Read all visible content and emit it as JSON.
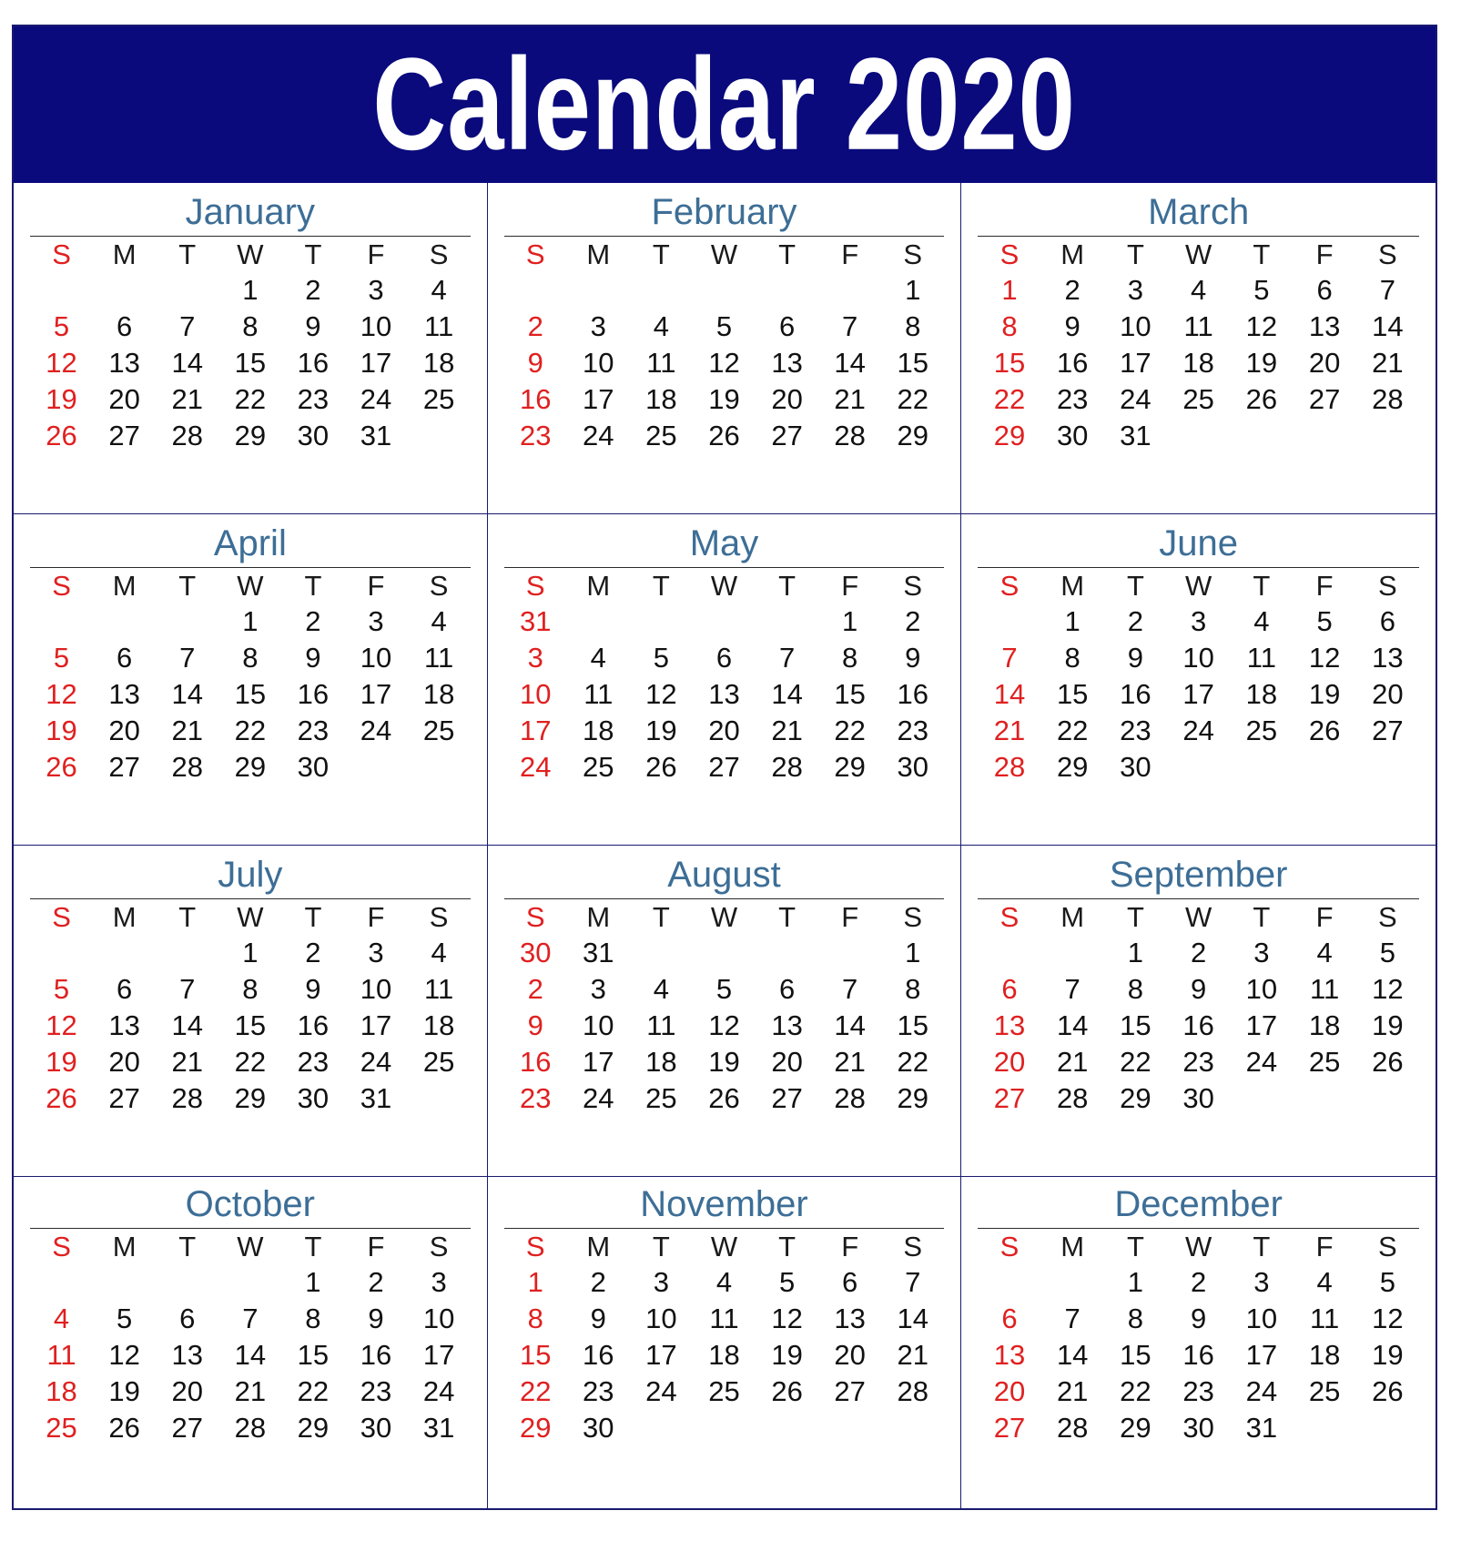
{
  "title": "Calendar 2020",
  "year": "2020",
  "colors": {
    "header_background": "#0a0a7d",
    "header_text": "#ffffff",
    "month_name": "#3d6e96",
    "sunday": "#e02020",
    "weekday": "#111111",
    "border": "#191970",
    "page_background": "#ffffff"
  },
  "weekday_headers": [
    "S",
    "M",
    "T",
    "W",
    "T",
    "F",
    "S"
  ],
  "months": [
    {
      "name": "January",
      "weeks": [
        [
          "",
          "",
          "",
          "1",
          "2",
          "3",
          "4"
        ],
        [
          "5",
          "6",
          "7",
          "8",
          "9",
          "10",
          "11"
        ],
        [
          "12",
          "13",
          "14",
          "15",
          "16",
          "17",
          "18"
        ],
        [
          "19",
          "20",
          "21",
          "22",
          "23",
          "24",
          "25"
        ],
        [
          "26",
          "27",
          "28",
          "29",
          "30",
          "31",
          ""
        ]
      ]
    },
    {
      "name": "February",
      "weeks": [
        [
          "",
          "",
          "",
          "",
          "",
          "",
          "1"
        ],
        [
          "2",
          "3",
          "4",
          "5",
          "6",
          "7",
          "8"
        ],
        [
          "9",
          "10",
          "11",
          "12",
          "13",
          "14",
          "15"
        ],
        [
          "16",
          "17",
          "18",
          "19",
          "20",
          "21",
          "22"
        ],
        [
          "23",
          "24",
          "25",
          "26",
          "27",
          "28",
          "29"
        ]
      ]
    },
    {
      "name": "March",
      "weeks": [
        [
          "1",
          "2",
          "3",
          "4",
          "5",
          "6",
          "7"
        ],
        [
          "8",
          "9",
          "10",
          "11",
          "12",
          "13",
          "14"
        ],
        [
          "15",
          "16",
          "17",
          "18",
          "19",
          "20",
          "21"
        ],
        [
          "22",
          "23",
          "24",
          "25",
          "26",
          "27",
          "28"
        ],
        [
          "29",
          "30",
          "31",
          "",
          "",
          "",
          ""
        ]
      ]
    },
    {
      "name": "April",
      "weeks": [
        [
          "",
          "",
          "",
          "1",
          "2",
          "3",
          "4"
        ],
        [
          "5",
          "6",
          "7",
          "8",
          "9",
          "10",
          "11"
        ],
        [
          "12",
          "13",
          "14",
          "15",
          "16",
          "17",
          "18"
        ],
        [
          "19",
          "20",
          "21",
          "22",
          "23",
          "24",
          "25"
        ],
        [
          "26",
          "27",
          "28",
          "29",
          "30",
          "",
          ""
        ]
      ]
    },
    {
      "name": "May",
      "weeks": [
        [
          "31",
          "",
          "",
          "",
          "",
          "1",
          "2"
        ],
        [
          "3",
          "4",
          "5",
          "6",
          "7",
          "8",
          "9"
        ],
        [
          "10",
          "11",
          "12",
          "13",
          "14",
          "15",
          "16"
        ],
        [
          "17",
          "18",
          "19",
          "20",
          "21",
          "22",
          "23"
        ],
        [
          "24",
          "25",
          "26",
          "27",
          "28",
          "29",
          "30"
        ]
      ]
    },
    {
      "name": "June",
      "weeks": [
        [
          "",
          "1",
          "2",
          "3",
          "4",
          "5",
          "6"
        ],
        [
          "7",
          "8",
          "9",
          "10",
          "11",
          "12",
          "13"
        ],
        [
          "14",
          "15",
          "16",
          "17",
          "18",
          "19",
          "20"
        ],
        [
          "21",
          "22",
          "23",
          "24",
          "25",
          "26",
          "27"
        ],
        [
          "28",
          "29",
          "30",
          "",
          "",
          "",
          ""
        ]
      ]
    },
    {
      "name": "July",
      "weeks": [
        [
          "",
          "",
          "",
          "1",
          "2",
          "3",
          "4"
        ],
        [
          "5",
          "6",
          "7",
          "8",
          "9",
          "10",
          "11"
        ],
        [
          "12",
          "13",
          "14",
          "15",
          "16",
          "17",
          "18"
        ],
        [
          "19",
          "20",
          "21",
          "22",
          "23",
          "24",
          "25"
        ],
        [
          "26",
          "27",
          "28",
          "29",
          "30",
          "31",
          ""
        ]
      ]
    },
    {
      "name": "August",
      "weeks": [
        [
          "30",
          "31",
          "",
          "",
          "",
          "",
          "1"
        ],
        [
          "2",
          "3",
          "4",
          "5",
          "6",
          "7",
          "8"
        ],
        [
          "9",
          "10",
          "11",
          "12",
          "13",
          "14",
          "15"
        ],
        [
          "16",
          "17",
          "18",
          "19",
          "20",
          "21",
          "22"
        ],
        [
          "23",
          "24",
          "25",
          "26",
          "27",
          "28",
          "29"
        ]
      ]
    },
    {
      "name": "September",
      "weeks": [
        [
          "",
          "",
          "1",
          "2",
          "3",
          "4",
          "5"
        ],
        [
          "6",
          "7",
          "8",
          "9",
          "10",
          "11",
          "12"
        ],
        [
          "13",
          "14",
          "15",
          "16",
          "17",
          "18",
          "19"
        ],
        [
          "20",
          "21",
          "22",
          "23",
          "24",
          "25",
          "26"
        ],
        [
          "27",
          "28",
          "29",
          "30",
          "",
          "",
          ""
        ]
      ]
    },
    {
      "name": "October",
      "weeks": [
        [
          "",
          "",
          "",
          "",
          "1",
          "2",
          "3"
        ],
        [
          "4",
          "5",
          "6",
          "7",
          "8",
          "9",
          "10"
        ],
        [
          "11",
          "12",
          "13",
          "14",
          "15",
          "16",
          "17"
        ],
        [
          "18",
          "19",
          "20",
          "21",
          "22",
          "23",
          "24"
        ],
        [
          "25",
          "26",
          "27",
          "28",
          "29",
          "30",
          "31"
        ]
      ]
    },
    {
      "name": "November",
      "weeks": [
        [
          "1",
          "2",
          "3",
          "4",
          "5",
          "6",
          "7"
        ],
        [
          "8",
          "9",
          "10",
          "11",
          "12",
          "13",
          "14"
        ],
        [
          "15",
          "16",
          "17",
          "18",
          "19",
          "20",
          "21"
        ],
        [
          "22",
          "23",
          "24",
          "25",
          "26",
          "27",
          "28"
        ],
        [
          "29",
          "30",
          "",
          "",
          "",
          "",
          ""
        ]
      ]
    },
    {
      "name": "December",
      "weeks": [
        [
          "",
          "",
          "1",
          "2",
          "3",
          "4",
          "5"
        ],
        [
          "6",
          "7",
          "8",
          "9",
          "10",
          "11",
          "12"
        ],
        [
          "13",
          "14",
          "15",
          "16",
          "17",
          "18",
          "19"
        ],
        [
          "20",
          "21",
          "22",
          "23",
          "24",
          "25",
          "26"
        ],
        [
          "27",
          "28",
          "29",
          "30",
          "31",
          "",
          ""
        ]
      ]
    }
  ]
}
